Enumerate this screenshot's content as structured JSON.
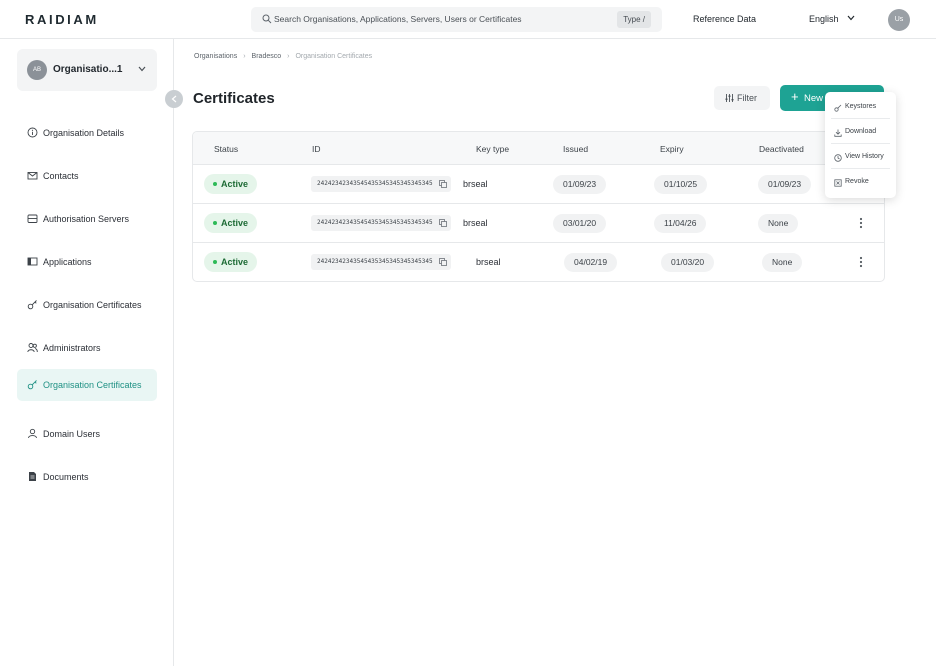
{
  "brand": {
    "logo_text": "RAIDIAM",
    "accent": "#1ea394",
    "active_green": "#2dba57"
  },
  "topbar": {
    "search_placeholder": "Search Organisations, Applications, Servers, Users or Certificates",
    "search_shortcut": "Type /",
    "reference_data": "Reference Data",
    "language": "English",
    "user_initials": "Us"
  },
  "sidebar": {
    "org_avatar": "AB",
    "org_name": "Organisatio...1",
    "items": [
      {
        "label": "Organisation Details",
        "icon": "info-icon",
        "active": false
      },
      {
        "label": "Contacts",
        "icon": "mail-icon",
        "active": false
      },
      {
        "label": "Authorisation Servers",
        "icon": "server-icon",
        "active": false
      },
      {
        "label": "Applications",
        "icon": "application-icon",
        "active": false
      },
      {
        "label": "Organisation Certificates",
        "icon": "key-icon",
        "active": false
      },
      {
        "label": "Administrators",
        "icon": "users-icon",
        "active": false
      },
      {
        "label": "Organisation Certificates",
        "icon": "key-icon",
        "active": true
      },
      {
        "label": "Domain Users",
        "icon": "user-icon",
        "active": false
      },
      {
        "label": "Documents",
        "icon": "document-icon",
        "active": false
      }
    ]
  },
  "breadcrumb": {
    "items": [
      "Organisations",
      "Bradesco",
      "Organisation Certificates"
    ]
  },
  "page": {
    "title": "Certificates",
    "filter_label": "Filter",
    "new_label": "New"
  },
  "table": {
    "columns": [
      "Status",
      "ID",
      "Key type",
      "Issued",
      "Expiry",
      "Deactivated"
    ],
    "rows": [
      {
        "status": "Active",
        "id": "24242342343545435345345345345345",
        "key_type": "brseal",
        "issued": "01/09/23",
        "expiry": "01/10/25",
        "deactivated": "01/09/23"
      },
      {
        "status": "Active",
        "id": "24242342343545435345345345345345",
        "key_type": "brseal",
        "issued": "03/01/20",
        "expiry": "11/04/26",
        "deactivated": "None"
      },
      {
        "status": "Active",
        "id": "24242342343545435345345345345345",
        "key_type": "brseal",
        "issued": "04/02/19",
        "expiry": "01/03/20",
        "deactivated": "None"
      }
    ]
  },
  "row_menu": {
    "items": [
      "Keystores",
      "Download",
      "View History",
      "Revoke"
    ]
  }
}
